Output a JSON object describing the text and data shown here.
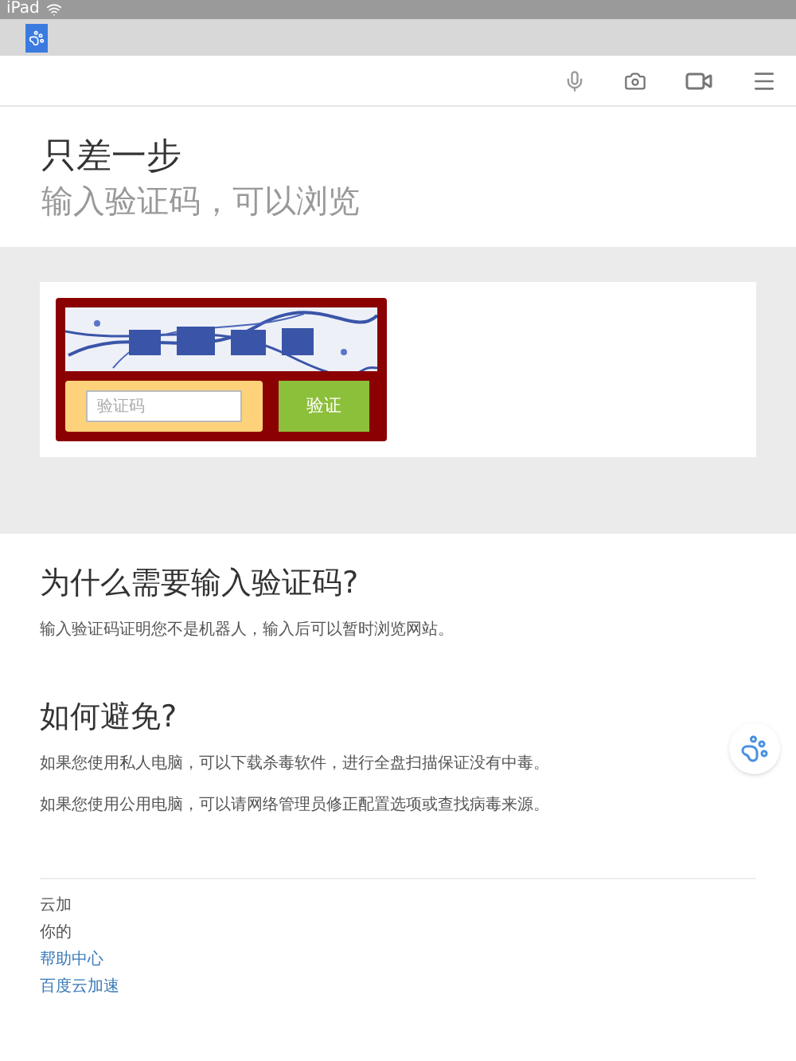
{
  "status_bar": {
    "device": "iPad"
  },
  "header": {
    "title": "只差一步",
    "subtitle": "输入验证码，可以浏览"
  },
  "captcha": {
    "input": {
      "placeholder": "验证码"
    },
    "button": "验证"
  },
  "sections": [
    {
      "heading": "为什么需要输入验证码?",
      "paragraphs": [
        "输入验证码证明您不是机器人，输入后可以暂时浏览网站。"
      ]
    },
    {
      "heading": "如何避免?",
      "paragraphs": [
        "如果您使用私人电脑，可以下载杀毒软件，进行全盘扫描保证没有中毒。",
        "如果您使用公用电脑，可以请网络管理员修正配置选项或查找病毒来源。"
      ]
    }
  ],
  "footer": {
    "lines": [
      "云加",
      "你的"
    ],
    "links": [
      "帮助中心",
      "百度云加速"
    ]
  }
}
